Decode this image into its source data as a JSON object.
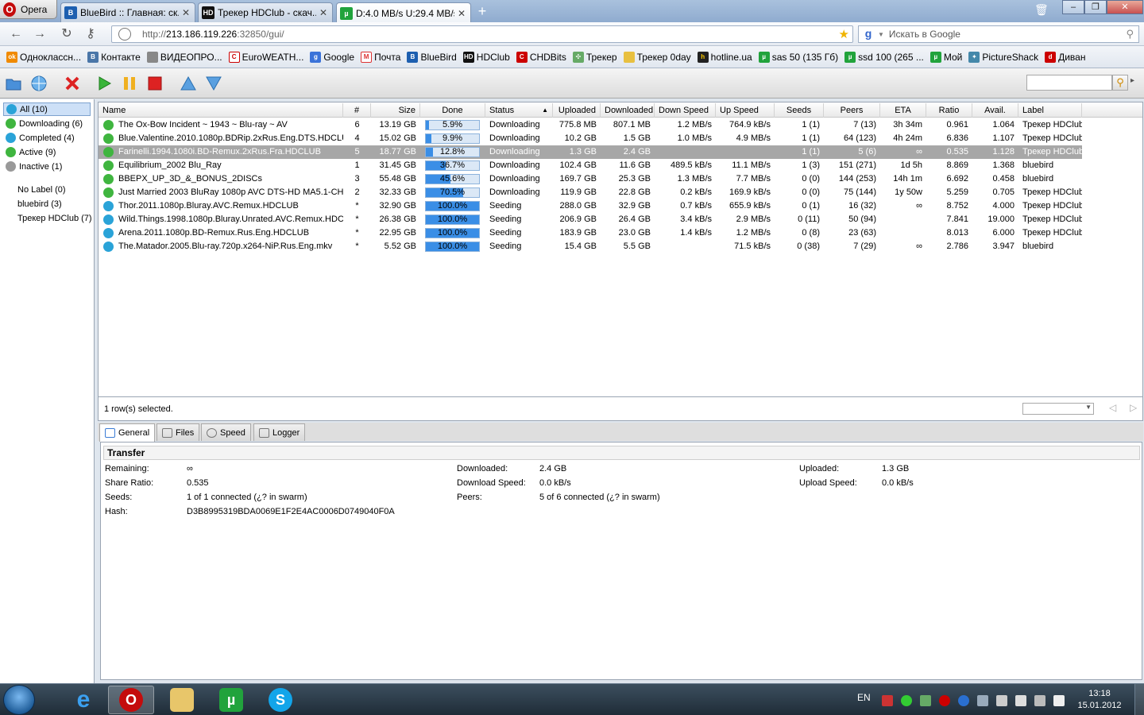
{
  "browser": {
    "opera_label": "Opera",
    "tabs": [
      {
        "title": "BlueBird :: Главная: ск...",
        "close": "✕"
      },
      {
        "title": "Трекер HDClub - скач...",
        "close": "✕"
      },
      {
        "title": "D:4.0 MB/s U:29.4 MB/s...",
        "close": "✕"
      }
    ],
    "new_tab": "+",
    "url_prefix": "http://",
    "url_host": "213.186.119.226",
    "url_rest": ":32850/gui/",
    "search_placeholder": "Искать в Google",
    "bookmarks": [
      "Одноклассн...",
      "Контакте",
      "ВИДЕОПРО...",
      "EuroWEATH...",
      "Google",
      "Почта",
      "BlueBird",
      "HDClub",
      "CHDBits",
      "Трекер",
      "Трекер 0day",
      "hotline.ua",
      "sas 50 (135 Гб)",
      "ssd 100 (265 ...",
      "Мой",
      "PictureShack",
      "Диван"
    ]
  },
  "sidebar": {
    "categories": [
      {
        "label": "All (10)",
        "color": "#2aa3d8"
      },
      {
        "label": "Downloading (6)",
        "color": "#3fb53f"
      },
      {
        "label": "Completed (4)",
        "color": "#2aa3d8"
      },
      {
        "label": "Active (9)",
        "color": "#3fb53f"
      },
      {
        "label": "Inactive (1)",
        "color": "#999999"
      }
    ],
    "labels": [
      "No Label (0)",
      "bluebird (3)",
      "Трекер HDClub (7)"
    ]
  },
  "columns": [
    "Name",
    "#",
    "Size",
    "Done",
    "Status",
    "Uploaded",
    "Downloaded",
    "Down Speed",
    "Up Speed",
    "Seeds",
    "Peers",
    "ETA",
    "Ratio",
    "Avail.",
    "Label"
  ],
  "torrents": [
    {
      "name": "The Ox-Bow Incident ~ 1943 ~ Blu-ray ~ AV",
      "num": "6",
      "size": "13.19 GB",
      "done": "5.9%",
      "pct": 5.9,
      "status": "Downloading",
      "uploaded": "775.8 MB",
      "downloaded": "807.1 MB",
      "down": "1.2 MB/s",
      "up": "764.9 kB/s",
      "seeds": "1 (1)",
      "peers": "7 (13)",
      "eta": "3h 34m",
      "ratio": "0.961",
      "avail": "1.064",
      "label": "Трекер HDClub",
      "color": "#3fb53f"
    },
    {
      "name": "Blue.Valentine.2010.1080p.BDRip.2xRus.Eng.DTS.HDCLUB",
      "num": "4",
      "size": "15.02 GB",
      "done": "9.9%",
      "pct": 9.9,
      "status": "Downloading",
      "uploaded": "10.2 GB",
      "downloaded": "1.5 GB",
      "down": "1.0 MB/s",
      "up": "4.9 MB/s",
      "seeds": "1 (1)",
      "peers": "64 (123)",
      "eta": "4h 24m",
      "ratio": "6.836",
      "avail": "1.107",
      "label": "Трекер HDClub",
      "color": "#3fb53f"
    },
    {
      "name": "Farinelli.1994.1080i.BD-Remux.2xRus.Fra.HDCLUB",
      "num": "5",
      "size": "18.77 GB",
      "done": "12.8%",
      "pct": 12.8,
      "status": "Downloading",
      "uploaded": "1.3 GB",
      "downloaded": "2.4 GB",
      "down": "",
      "up": "",
      "seeds": "1 (1)",
      "peers": "5 (6)",
      "eta": "∞",
      "ratio": "0.535",
      "avail": "1.128",
      "label": "Трекер HDClub",
      "color": "#3fb53f"
    },
    {
      "name": "Equilibrium_2002 Blu_Ray",
      "num": "1",
      "size": "31.45 GB",
      "done": "36.7%",
      "pct": 36.7,
      "status": "Downloading",
      "uploaded": "102.4 GB",
      "downloaded": "11.6 GB",
      "down": "489.5 kB/s",
      "up": "11.1 MB/s",
      "seeds": "1 (3)",
      "peers": "151 (271)",
      "eta": "1d 5h",
      "ratio": "8.869",
      "avail": "1.368",
      "label": "bluebird",
      "color": "#3fb53f"
    },
    {
      "name": "BBEPX_UP_3D_&_BONUS_2DISCs",
      "num": "3",
      "size": "55.48 GB",
      "done": "45.6%",
      "pct": 45.6,
      "status": "Downloading",
      "uploaded": "169.7 GB",
      "downloaded": "25.3 GB",
      "down": "1.3 MB/s",
      "up": "7.7 MB/s",
      "seeds": "0 (0)",
      "peers": "144 (253)",
      "eta": "14h 1m",
      "ratio": "6.692",
      "avail": "0.458",
      "label": "bluebird",
      "color": "#3fb53f"
    },
    {
      "name": "Just Married 2003 BluRay 1080p AVC DTS-HD MA5.1-CHDBits",
      "num": "2",
      "size": "32.33 GB",
      "done": "70.5%",
      "pct": 70.5,
      "status": "Downloading",
      "uploaded": "119.9 GB",
      "downloaded": "22.8 GB",
      "down": "0.2 kB/s",
      "up": "169.9 kB/s",
      "seeds": "0 (0)",
      "peers": "75 (144)",
      "eta": "1y 50w",
      "ratio": "5.259",
      "avail": "0.705",
      "label": "Трекер HDClub",
      "color": "#3fb53f"
    },
    {
      "name": "Thor.2011.1080p.Bluray.AVC.Remux.HDCLUB",
      "num": "*",
      "size": "32.90 GB",
      "done": "100.0%",
      "pct": 100,
      "status": "Seeding",
      "uploaded": "288.0 GB",
      "downloaded": "32.9 GB",
      "down": "0.7 kB/s",
      "up": "655.9 kB/s",
      "seeds": "0 (1)",
      "peers": "16 (32)",
      "eta": "∞",
      "ratio": "8.752",
      "avail": "4.000",
      "label": "Трекер HDClub",
      "color": "#2aa3d8"
    },
    {
      "name": "Wild.Things.1998.1080p.Bluray.Unrated.AVC.Remux.HDCLUB",
      "num": "*",
      "size": "26.38 GB",
      "done": "100.0%",
      "pct": 100,
      "status": "Seeding",
      "uploaded": "206.9 GB",
      "downloaded": "26.4 GB",
      "down": "3.4 kB/s",
      "up": "2.9 MB/s",
      "seeds": "0 (11)",
      "peers": "50 (94)",
      "eta": "",
      "ratio": "7.841",
      "avail": "19.000",
      "label": "Трекер HDClub",
      "color": "#2aa3d8"
    },
    {
      "name": "Arena.2011.1080p.BD-Remux.Rus.Eng.HDCLUB",
      "num": "*",
      "size": "22.95 GB",
      "done": "100.0%",
      "pct": 100,
      "status": "Seeding",
      "uploaded": "183.9 GB",
      "downloaded": "23.0 GB",
      "down": "1.4 kB/s",
      "up": "1.2 MB/s",
      "seeds": "0 (8)",
      "peers": "23 (63)",
      "eta": "",
      "ratio": "8.013",
      "avail": "6.000",
      "label": "Трекер HDClub",
      "color": "#2aa3d8"
    },
    {
      "name": "The.Matador.2005.Blu-ray.720p.x264-NiP.Rus.Eng.mkv",
      "num": "*",
      "size": "5.52 GB",
      "done": "100.0%",
      "pct": 100,
      "status": "Seeding",
      "uploaded": "15.4 GB",
      "downloaded": "5.5 GB",
      "down": "",
      "up": "71.5 kB/s",
      "seeds": "0 (38)",
      "peers": "7 (29)",
      "eta": "∞",
      "ratio": "2.786",
      "avail": "3.947",
      "label": "bluebird",
      "color": "#2aa3d8"
    }
  ],
  "selected_row": 2,
  "status_text": "1 row(s) selected.",
  "detail_tabs": [
    "General",
    "Files",
    "Speed",
    "Logger"
  ],
  "transfer": {
    "title": "Transfer",
    "remaining_label": "Remaining:",
    "remaining": "∞",
    "share_ratio_label": "Share Ratio:",
    "share_ratio": "0.535",
    "seeds_label": "Seeds:",
    "seeds": "1 of 1 connected (¿? in swarm)",
    "hash_label": "Hash:",
    "hash": "D3B8995319BDA0069E1F2E4AC0006D0749040F0A",
    "downloaded_label": "Downloaded:",
    "downloaded": "2.4 GB",
    "download_speed_label": "Download Speed:",
    "download_speed": "0.0 kB/s",
    "peers_label": "Peers:",
    "peers": "5 of 6 connected (¿? in swarm)",
    "uploaded_label": "Uploaded:",
    "uploaded": "1.3 GB",
    "upload_speed_label": "Upload Speed:",
    "upload_speed": "0.0 kB/s"
  },
  "taskbar": {
    "lang": "EN",
    "time": "13:18",
    "date": "15.01.2012"
  }
}
